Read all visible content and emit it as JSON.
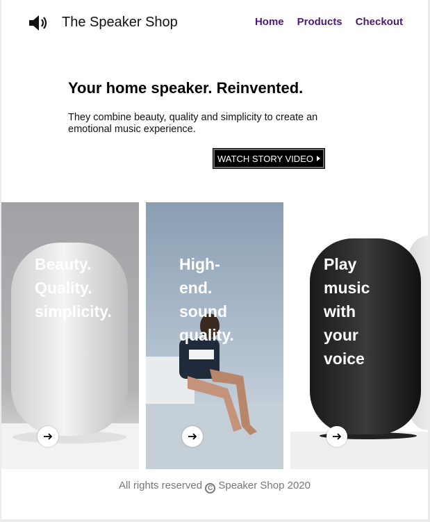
{
  "header": {
    "logo_icon": "speaker-volume-icon",
    "brand": "The Speaker Shop",
    "nav": [
      "Home",
      "Products",
      "Checkout"
    ],
    "nav_color": "#4b1a78"
  },
  "hero": {
    "title": "Your home speaker. Reinvented.",
    "description": "They combine beauty, quality and simplicity to create an emotional music experience.",
    "cta_label": "WATCH STORY VIDEO"
  },
  "cards": [
    {
      "lines": [
        "Beauty.",
        "Quality.",
        "simplicity."
      ],
      "arrow_icon": "arrow-right-icon"
    },
    {
      "lines": [
        "High-",
        "end.",
        "sound",
        "quality."
      ],
      "arrow_icon": "arrow-right-icon"
    },
    {
      "lines": [
        "Play",
        "music",
        "with",
        "your",
        "voice"
      ],
      "arrow_icon": "arrow-right-icon"
    }
  ],
  "footer": {
    "text_before": "All rights reserved",
    "symbol": "C",
    "text_after": "Speaker Shop 2020"
  }
}
